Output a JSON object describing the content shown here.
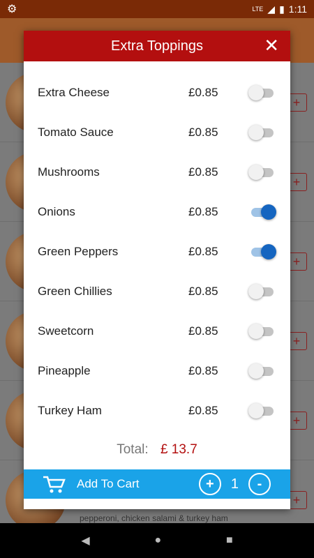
{
  "status": {
    "network": "LTE",
    "time": "1:11"
  },
  "background": {
    "caption": "pepperoni, chicken salami & turkey ham"
  },
  "dialog": {
    "title": "Extra Toppings",
    "close_icon": "close-icon",
    "toppings": [
      {
        "name": "Extra Cheese",
        "price": "£0.85",
        "on": false
      },
      {
        "name": "Tomato Sauce",
        "price": "£0.85",
        "on": false
      },
      {
        "name": "Mushrooms",
        "price": "£0.85",
        "on": false
      },
      {
        "name": "Onions",
        "price": "£0.85",
        "on": true
      },
      {
        "name": "Green Peppers",
        "price": "£0.85",
        "on": true
      },
      {
        "name": "Green Chillies",
        "price": "£0.85",
        "on": false
      },
      {
        "name": "Sweetcorn",
        "price": "£0.85",
        "on": false
      },
      {
        "name": "Pineapple",
        "price": "£0.85",
        "on": false
      },
      {
        "name": "Turkey Ham",
        "price": "£0.85",
        "on": false
      }
    ],
    "total_label": "Total:",
    "total_value": "£ 13.7",
    "cart": {
      "label": "Add To Cart",
      "plus": "+",
      "minus": "-",
      "quantity": "1"
    }
  },
  "colors": {
    "header": "#b30f0f",
    "cart_bar": "#1aa3e8",
    "toggle_on": "#1565c0"
  }
}
